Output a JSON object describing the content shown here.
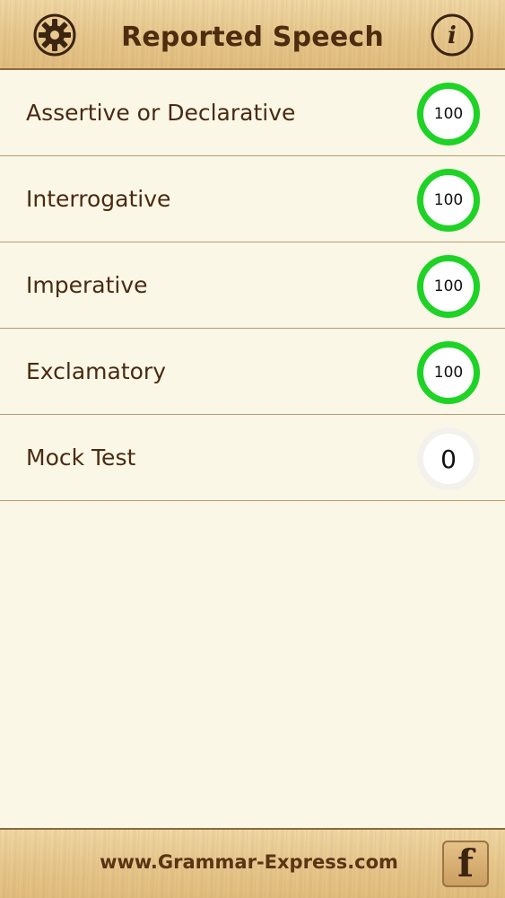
{
  "header": {
    "title": "Reported Speech",
    "settings_icon": "gear-icon",
    "info_icon": "info-icon",
    "info_glyph": "i"
  },
  "items": [
    {
      "label": "Assertive or Declarative",
      "score": "100",
      "status": "complete"
    },
    {
      "label": "Interrogative",
      "score": "100",
      "status": "complete"
    },
    {
      "label": "Imperative",
      "score": "100",
      "status": "complete"
    },
    {
      "label": "Exclamatory",
      "score": "100",
      "status": "complete"
    },
    {
      "label": "Mock Test",
      "score": "0",
      "status": "empty"
    }
  ],
  "footer": {
    "website": "www.Grammar-Express.com",
    "facebook_glyph": "f",
    "facebook_icon": "facebook-icon"
  },
  "colors": {
    "ring_complete": "#1ed326",
    "text_brown": "#4a2a12",
    "background": "#fbf7e6"
  }
}
